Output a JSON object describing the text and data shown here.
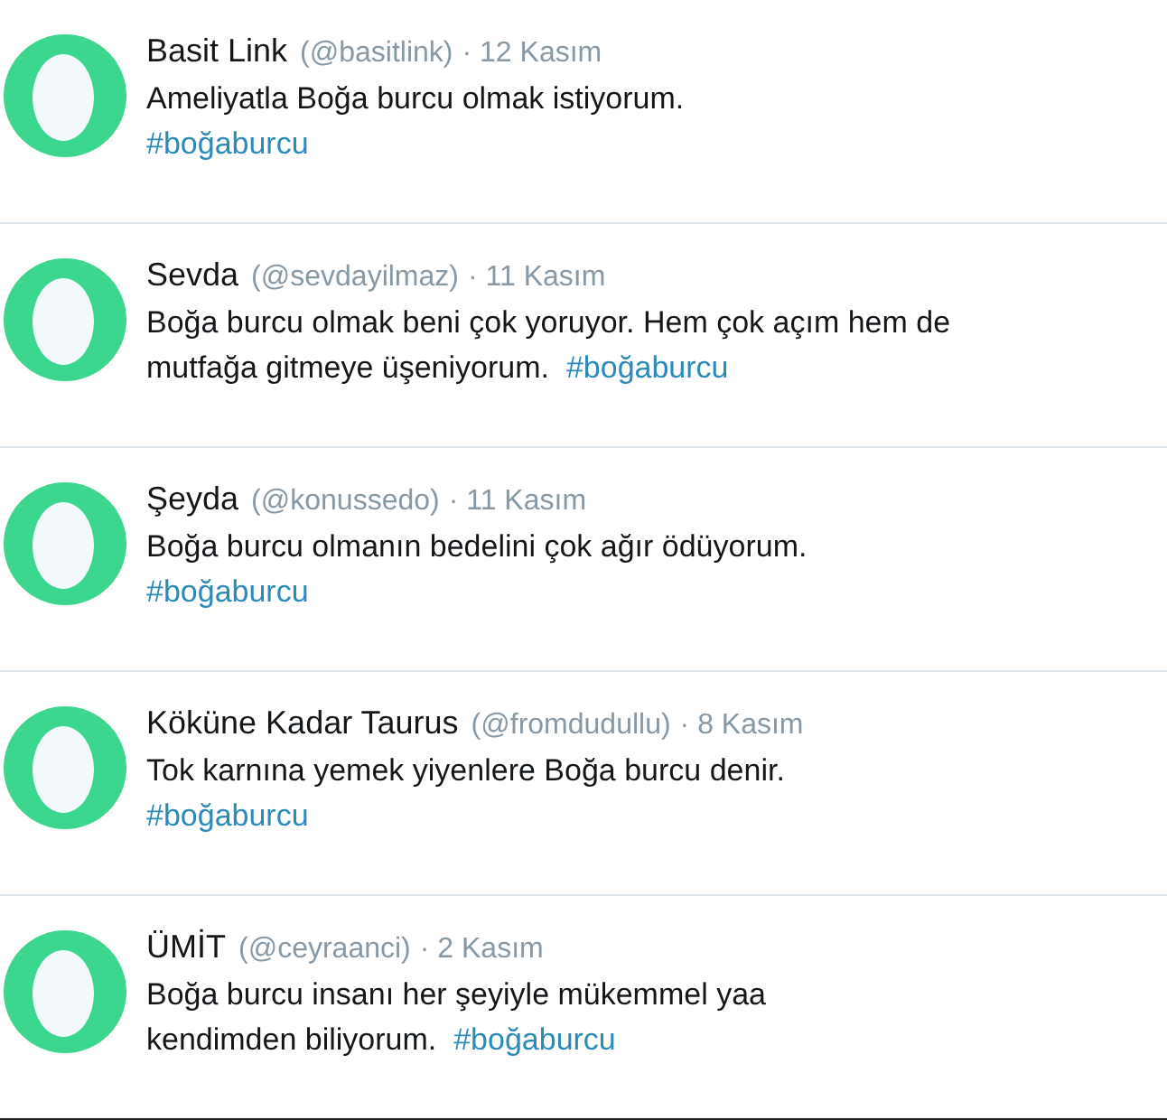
{
  "tweets": [
    {
      "name": "Basit Link",
      "handle": "(@basitlink)",
      "date": "· 12 Kasım",
      "lines": [
        [
          {
            "kind": "text",
            "text": "Ameliyatla Boğa burcu olmak istiyorum."
          }
        ],
        [
          {
            "kind": "hashtag",
            "text": "#boğaburcu"
          }
        ]
      ]
    },
    {
      "name": "Sevda",
      "handle": "(@sevdayilmaz)",
      "date": "· 11 Kasım",
      "lines": [
        [
          {
            "kind": "text",
            "text": "Boğa burcu olmak beni çok yoruyor. Hem çok açım hem de"
          }
        ],
        [
          {
            "kind": "text",
            "text": "mutfağa gitmeye üşeniyorum."
          },
          {
            "kind": "hashtag",
            "text": "#boğaburcu"
          }
        ]
      ]
    },
    {
      "name": "Şeyda",
      "handle": "(@konussedo)",
      "date": "· 11 Kasım",
      "lines": [
        [
          {
            "kind": "text",
            "text": "Boğa burcu olmanın bedelini çok ağır ödüyorum."
          }
        ],
        [
          {
            "kind": "hashtag",
            "text": "#boğaburcu"
          }
        ]
      ]
    },
    {
      "name": "Köküne Kadar Taurus",
      "handle": "(@fromdudullu)",
      "date": "· 8 Kasım",
      "lines": [
        [
          {
            "kind": "text",
            "text": "Tok karnına yemek yiyenlere Boğa burcu denir."
          }
        ],
        [
          {
            "kind": "hashtag",
            "text": "#boğaburcu"
          }
        ]
      ]
    },
    {
      "name": "ÜMİT",
      "handle": "(@ceyraanci)",
      "date": "· 2 Kasım",
      "lines": [
        [
          {
            "kind": "text",
            "text": "Boğa burcu insanı her şeyiyle mükemmel yaa"
          }
        ],
        [
          {
            "kind": "text",
            "text": "kendimden biliyorum."
          },
          {
            "kind": "hashtag",
            "text": "#boğaburcu"
          }
        ]
      ]
    }
  ]
}
